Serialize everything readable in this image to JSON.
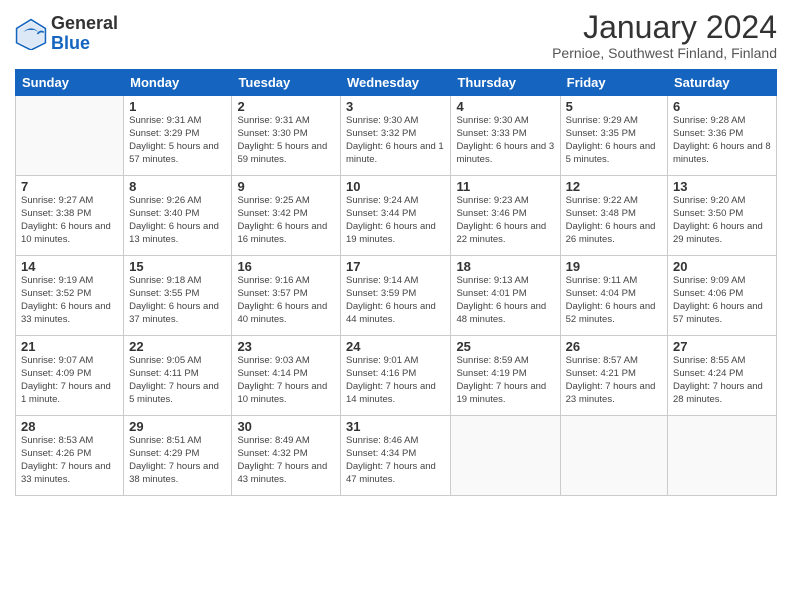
{
  "logo": {
    "general": "General",
    "blue": "Blue"
  },
  "header": {
    "title": "January 2024",
    "subtitle": "Pernioe, Southwest Finland, Finland"
  },
  "days_of_week": [
    "Sunday",
    "Monday",
    "Tuesday",
    "Wednesday",
    "Thursday",
    "Friday",
    "Saturday"
  ],
  "weeks": [
    [
      {
        "day": "",
        "info": ""
      },
      {
        "day": "1",
        "info": "Sunrise: 9:31 AM\nSunset: 3:29 PM\nDaylight: 5 hours\nand 57 minutes."
      },
      {
        "day": "2",
        "info": "Sunrise: 9:31 AM\nSunset: 3:30 PM\nDaylight: 5 hours\nand 59 minutes."
      },
      {
        "day": "3",
        "info": "Sunrise: 9:30 AM\nSunset: 3:32 PM\nDaylight: 6 hours\nand 1 minute."
      },
      {
        "day": "4",
        "info": "Sunrise: 9:30 AM\nSunset: 3:33 PM\nDaylight: 6 hours\nand 3 minutes."
      },
      {
        "day": "5",
        "info": "Sunrise: 9:29 AM\nSunset: 3:35 PM\nDaylight: 6 hours\nand 5 minutes."
      },
      {
        "day": "6",
        "info": "Sunrise: 9:28 AM\nSunset: 3:36 PM\nDaylight: 6 hours\nand 8 minutes."
      }
    ],
    [
      {
        "day": "7",
        "info": "Sunrise: 9:27 AM\nSunset: 3:38 PM\nDaylight: 6 hours\nand 10 minutes."
      },
      {
        "day": "8",
        "info": "Sunrise: 9:26 AM\nSunset: 3:40 PM\nDaylight: 6 hours\nand 13 minutes."
      },
      {
        "day": "9",
        "info": "Sunrise: 9:25 AM\nSunset: 3:42 PM\nDaylight: 6 hours\nand 16 minutes."
      },
      {
        "day": "10",
        "info": "Sunrise: 9:24 AM\nSunset: 3:44 PM\nDaylight: 6 hours\nand 19 minutes."
      },
      {
        "day": "11",
        "info": "Sunrise: 9:23 AM\nSunset: 3:46 PM\nDaylight: 6 hours\nand 22 minutes."
      },
      {
        "day": "12",
        "info": "Sunrise: 9:22 AM\nSunset: 3:48 PM\nDaylight: 6 hours\nand 26 minutes."
      },
      {
        "day": "13",
        "info": "Sunrise: 9:20 AM\nSunset: 3:50 PM\nDaylight: 6 hours\nand 29 minutes."
      }
    ],
    [
      {
        "day": "14",
        "info": "Sunrise: 9:19 AM\nSunset: 3:52 PM\nDaylight: 6 hours\nand 33 minutes."
      },
      {
        "day": "15",
        "info": "Sunrise: 9:18 AM\nSunset: 3:55 PM\nDaylight: 6 hours\nand 37 minutes."
      },
      {
        "day": "16",
        "info": "Sunrise: 9:16 AM\nSunset: 3:57 PM\nDaylight: 6 hours\nand 40 minutes."
      },
      {
        "day": "17",
        "info": "Sunrise: 9:14 AM\nSunset: 3:59 PM\nDaylight: 6 hours\nand 44 minutes."
      },
      {
        "day": "18",
        "info": "Sunrise: 9:13 AM\nSunset: 4:01 PM\nDaylight: 6 hours\nand 48 minutes."
      },
      {
        "day": "19",
        "info": "Sunrise: 9:11 AM\nSunset: 4:04 PM\nDaylight: 6 hours\nand 52 minutes."
      },
      {
        "day": "20",
        "info": "Sunrise: 9:09 AM\nSunset: 4:06 PM\nDaylight: 6 hours\nand 57 minutes."
      }
    ],
    [
      {
        "day": "21",
        "info": "Sunrise: 9:07 AM\nSunset: 4:09 PM\nDaylight: 7 hours\nand 1 minute."
      },
      {
        "day": "22",
        "info": "Sunrise: 9:05 AM\nSunset: 4:11 PM\nDaylight: 7 hours\nand 5 minutes."
      },
      {
        "day": "23",
        "info": "Sunrise: 9:03 AM\nSunset: 4:14 PM\nDaylight: 7 hours\nand 10 minutes."
      },
      {
        "day": "24",
        "info": "Sunrise: 9:01 AM\nSunset: 4:16 PM\nDaylight: 7 hours\nand 14 minutes."
      },
      {
        "day": "25",
        "info": "Sunrise: 8:59 AM\nSunset: 4:19 PM\nDaylight: 7 hours\nand 19 minutes."
      },
      {
        "day": "26",
        "info": "Sunrise: 8:57 AM\nSunset: 4:21 PM\nDaylight: 7 hours\nand 23 minutes."
      },
      {
        "day": "27",
        "info": "Sunrise: 8:55 AM\nSunset: 4:24 PM\nDaylight: 7 hours\nand 28 minutes."
      }
    ],
    [
      {
        "day": "28",
        "info": "Sunrise: 8:53 AM\nSunset: 4:26 PM\nDaylight: 7 hours\nand 33 minutes."
      },
      {
        "day": "29",
        "info": "Sunrise: 8:51 AM\nSunset: 4:29 PM\nDaylight: 7 hours\nand 38 minutes."
      },
      {
        "day": "30",
        "info": "Sunrise: 8:49 AM\nSunset: 4:32 PM\nDaylight: 7 hours\nand 43 minutes."
      },
      {
        "day": "31",
        "info": "Sunrise: 8:46 AM\nSunset: 4:34 PM\nDaylight: 7 hours\nand 47 minutes."
      },
      {
        "day": "",
        "info": ""
      },
      {
        "day": "",
        "info": ""
      },
      {
        "day": "",
        "info": ""
      }
    ]
  ]
}
